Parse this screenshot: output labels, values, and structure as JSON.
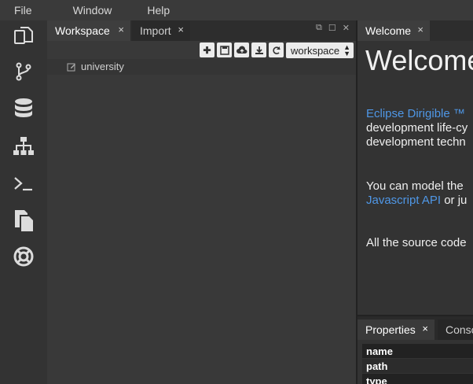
{
  "menubar": {
    "file": "File",
    "window": "Window",
    "help": "Help"
  },
  "activity_icons": [
    "workspace-icon",
    "git-icon",
    "database-icon",
    "hierarchy-icon",
    "terminal-icon",
    "documents-icon",
    "help-ring-icon"
  ],
  "left_pane": {
    "tabs": [
      {
        "label": "Workspace",
        "close": "×"
      },
      {
        "label": "Import",
        "close": "×"
      }
    ],
    "toolbar": {
      "workspace_select": "workspace"
    },
    "tree": [
      {
        "label": "university"
      }
    ]
  },
  "right_pane": {
    "tab": {
      "label": "Welcome",
      "close": "×"
    },
    "title": "Welcome",
    "para1": {
      "link": "Eclipse Dirigible ™",
      "line2": "development life-cy",
      "line3": "development techn"
    },
    "para2": {
      "line1": "You can model the",
      "link": "Javascript API",
      "rest": " or ju"
    },
    "para3": "All the source code"
  },
  "properties_panel": {
    "tabs": [
      {
        "label": "Properties",
        "close": "×"
      },
      {
        "label": "Conso"
      }
    ],
    "rows": [
      "name",
      "path",
      "type"
    ]
  }
}
